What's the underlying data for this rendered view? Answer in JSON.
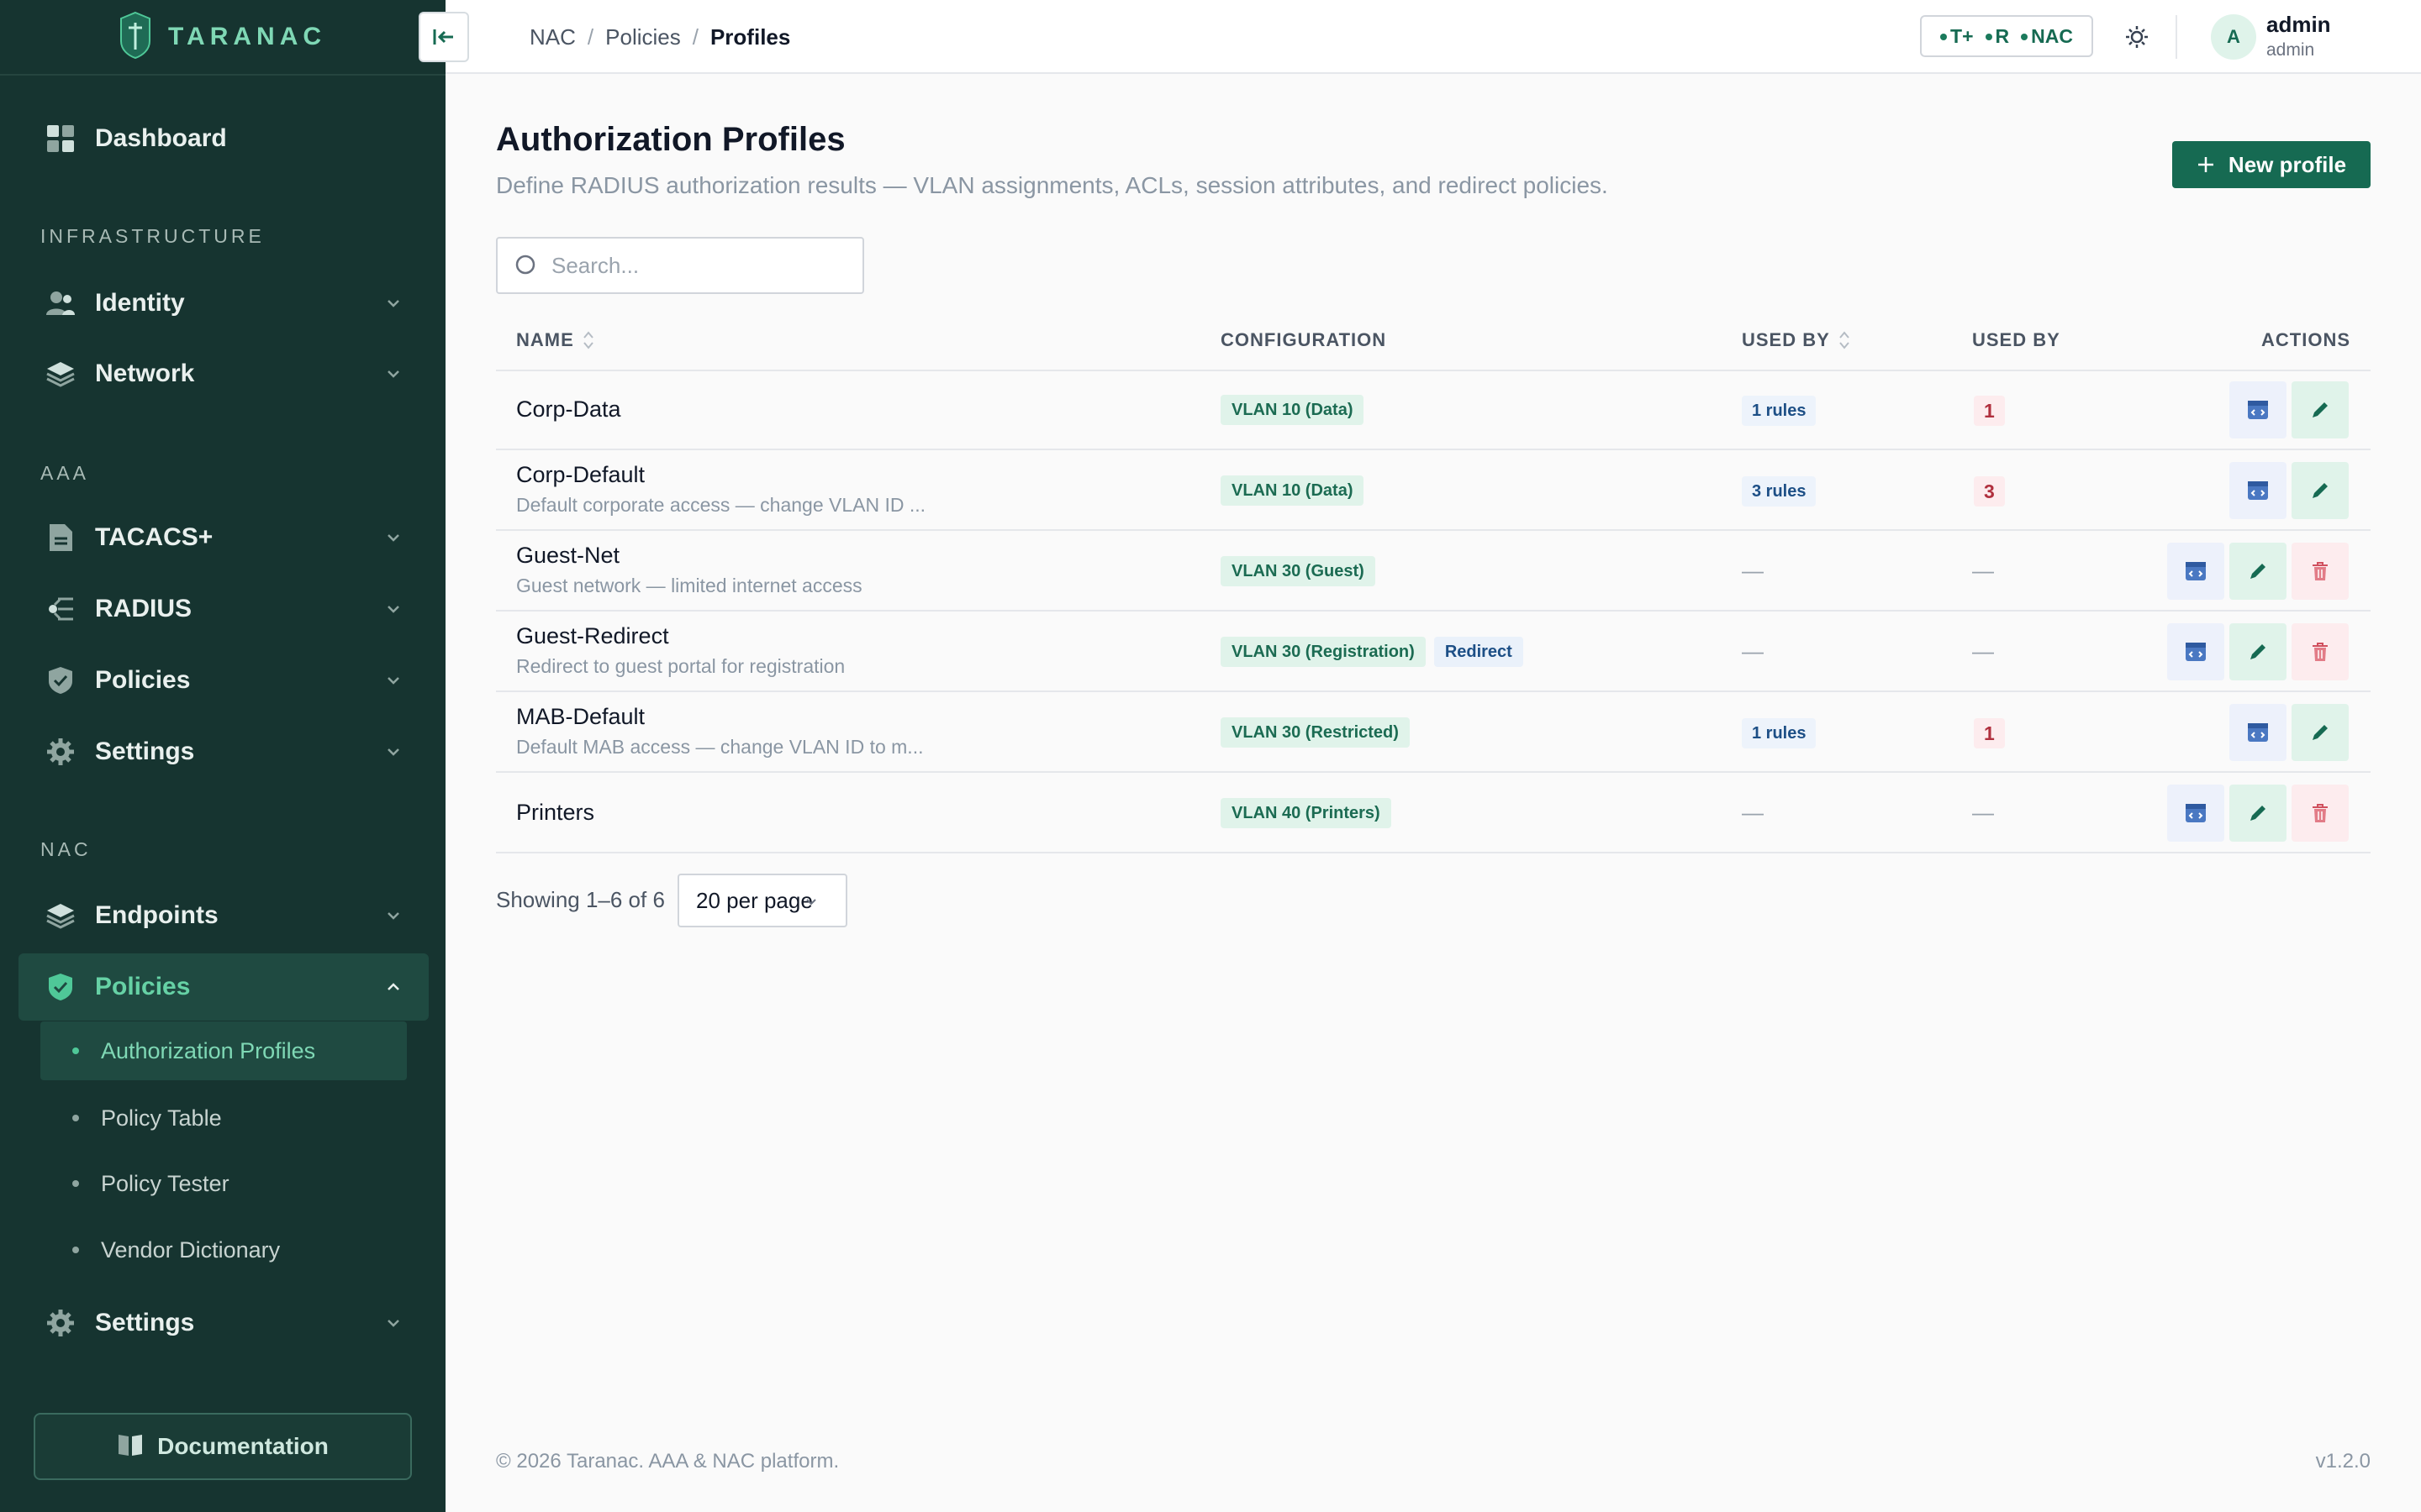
{
  "app": {
    "name": "TARANAC"
  },
  "sidebar": {
    "dashboard": "Dashboard",
    "sections": {
      "infrastructure": "INFRASTRUCTURE",
      "aaa": "AAA",
      "nac": "NAC"
    },
    "identity": "Identity",
    "network": "Network",
    "tacacs": "TACACS+",
    "radius": "RADIUS",
    "aaa_policies": "Policies",
    "aaa_settings": "Settings",
    "endpoints": "Endpoints",
    "nac_policies": "Policies",
    "sub_items": [
      "Authorization Profiles",
      "Policy Table",
      "Policy Tester",
      "Vendor Dictionary"
    ],
    "nac_settings": "Settings",
    "documentation": "Documentation"
  },
  "header": {
    "breadcrumb": [
      "NAC",
      "Policies",
      "Profiles"
    ],
    "breadcrumb_sep": "/",
    "protocols": [
      "T+",
      "R",
      "NAC"
    ],
    "user": {
      "initial": "A",
      "name": "admin",
      "role": "admin"
    }
  },
  "page": {
    "title": "Authorization Profiles",
    "subtitle": "Define RADIUS authorization results — VLAN assignments, ACLs, session attributes, and redirect policies.",
    "new_button": "New profile",
    "search_placeholder": "Search...",
    "columns": [
      "NAME",
      "CONFIGURATION",
      "USED BY",
      "USED BY",
      "ACTIONS"
    ],
    "rows": [
      {
        "name": "Corp-Data",
        "desc": "",
        "tags": [
          "VLAN 10 (Data)"
        ],
        "rules": "1 rules",
        "count": "1",
        "actions": [
          "view",
          "edit"
        ]
      },
      {
        "name": "Corp-Default",
        "desc": "Default corporate access — change VLAN ID ...",
        "tags": [
          "VLAN 10 (Data)"
        ],
        "rules": "3 rules",
        "count": "3",
        "actions": [
          "view",
          "edit"
        ]
      },
      {
        "name": "Guest-Net",
        "desc": "Guest network — limited internet access",
        "tags": [
          "VLAN 30 (Guest)"
        ],
        "rules": "—",
        "count": "—",
        "actions": [
          "view",
          "edit",
          "delete"
        ]
      },
      {
        "name": "Guest-Redirect",
        "desc": "Redirect to guest portal for registration",
        "tags": [
          "VLAN 30 (Registration)",
          "Redirect"
        ],
        "rules": "—",
        "count": "—",
        "actions": [
          "view",
          "edit",
          "delete"
        ]
      },
      {
        "name": "MAB-Default",
        "desc": "Default MAB access — change VLAN ID to m...",
        "tags": [
          "VLAN 30 (Restricted)"
        ],
        "rules": "1 rules",
        "count": "1",
        "actions": [
          "view",
          "edit"
        ]
      },
      {
        "name": "Printers",
        "desc": "",
        "tags": [
          "VLAN 40 (Printers)"
        ],
        "rules": "—",
        "count": "—",
        "actions": [
          "view",
          "edit",
          "delete"
        ]
      }
    ],
    "showing": "Showing 1–6 of 6",
    "per_page": "20 per page"
  },
  "footer": {
    "copyright": "© 2026 Taranac. AAA & NAC platform.",
    "version": "v1.2.0"
  },
  "colors": {
    "sidebar_bg": "#163430",
    "accent": "#166a52",
    "accent_light": "#7fd8b5",
    "danger": "#b0303e",
    "info": "#1d4f86"
  }
}
